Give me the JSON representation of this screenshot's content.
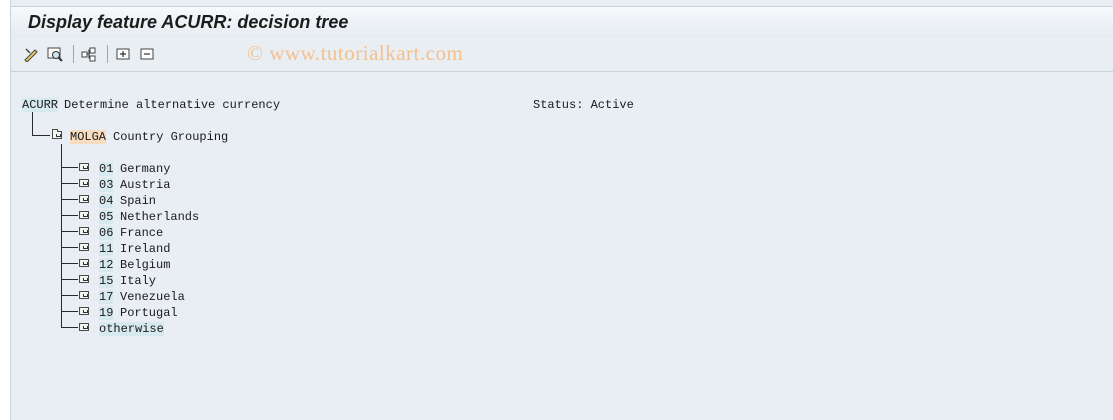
{
  "window": {
    "title": "Display feature ACURR: decision tree",
    "watermark": "© www.tutorialkart.com"
  },
  "toolbar": {
    "icons": [
      "change-icon",
      "display-icon",
      "structure-icon",
      "expand-icon",
      "collapse-icon"
    ]
  },
  "feature": {
    "code": "ACURR",
    "description": "Determine alternative currency",
    "status": "Status: Active"
  },
  "group": {
    "code": "MOLGA",
    "description": "Country Grouping"
  },
  "nodes": [
    {
      "code": "01",
      "label": "Germany"
    },
    {
      "code": "03",
      "label": "Austria"
    },
    {
      "code": "04",
      "label": "Spain"
    },
    {
      "code": "05",
      "label": "Netherlands"
    },
    {
      "code": "06",
      "label": "France"
    },
    {
      "code": "11",
      "label": "Ireland"
    },
    {
      "code": "12",
      "label": "Belgium"
    },
    {
      "code": "15",
      "label": "Italy"
    },
    {
      "code": "17",
      "label": "Venezuela"
    },
    {
      "code": "19",
      "label": "Portugal"
    }
  ],
  "otherwise": "otherwise"
}
